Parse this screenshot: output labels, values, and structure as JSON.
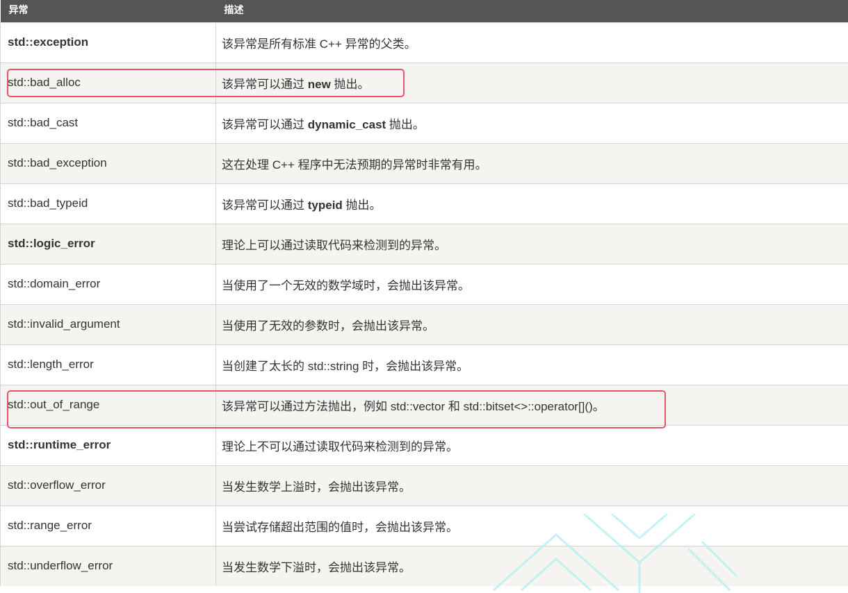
{
  "table": {
    "headers": [
      "异常",
      "描述"
    ],
    "rows": [
      {
        "name": "std::exception",
        "bold": true,
        "desc": [
          {
            "t": "该异常是所有标准 C++ 异常的父类。"
          }
        ]
      },
      {
        "name": "std::bad_alloc",
        "bold": false,
        "desc": [
          {
            "t": "该异常可以通过 "
          },
          {
            "t": "new",
            "b": true
          },
          {
            "t": " 抛出。"
          }
        ]
      },
      {
        "name": "std::bad_cast",
        "bold": false,
        "desc": [
          {
            "t": "该异常可以通过 "
          },
          {
            "t": "dynamic_cast",
            "b": true
          },
          {
            "t": " 抛出。"
          }
        ]
      },
      {
        "name": "std::bad_exception",
        "bold": false,
        "desc": [
          {
            "t": "这在处理 C++ 程序中无法预期的异常时非常有用。"
          }
        ]
      },
      {
        "name": "std::bad_typeid",
        "bold": false,
        "desc": [
          {
            "t": "该异常可以通过 "
          },
          {
            "t": "typeid",
            "b": true
          },
          {
            "t": " 抛出。"
          }
        ]
      },
      {
        "name": "std::logic_error",
        "bold": true,
        "desc": [
          {
            "t": "理论上可以通过读取代码来检测到的异常。"
          }
        ]
      },
      {
        "name": "std::domain_error",
        "bold": false,
        "desc": [
          {
            "t": "当使用了一个无效的数学域时，会抛出该异常。"
          }
        ]
      },
      {
        "name": "std::invalid_argument",
        "bold": false,
        "desc": [
          {
            "t": "当使用了无效的参数时，会抛出该异常。"
          }
        ]
      },
      {
        "name": "std::length_error",
        "bold": false,
        "desc": [
          {
            "t": "当创建了太长的 std::string 时，会抛出该异常。"
          }
        ]
      },
      {
        "name": "std::out_of_range",
        "bold": false,
        "desc": [
          {
            "t": "该异常可以通过方法抛出，例如 std::vector 和 std::bitset<>::operator[]()。"
          }
        ]
      },
      {
        "name": "std::runtime_error",
        "bold": true,
        "desc": [
          {
            "t": "理论上不可以通过读取代码来检测到的异常。"
          }
        ]
      },
      {
        "name": "std::overflow_error",
        "bold": false,
        "desc": [
          {
            "t": "当发生数学上溢时，会抛出该异常。"
          }
        ]
      },
      {
        "name": "std::range_error",
        "bold": false,
        "desc": [
          {
            "t": "当尝试存储超出范围的值时，会抛出该异常。"
          }
        ]
      },
      {
        "name": "std::underflow_error",
        "bold": false,
        "desc": [
          {
            "t": "当发生数学下溢时，会抛出该异常。"
          }
        ]
      }
    ]
  },
  "colors": {
    "header_bg": "#555555",
    "highlight_border": "#e5536a",
    "row_alt_bg": "#f6f4f0",
    "watermark": "#b8f0f4"
  },
  "highlighted_rows": [
    "std::bad_alloc",
    "std::out_of_range"
  ]
}
